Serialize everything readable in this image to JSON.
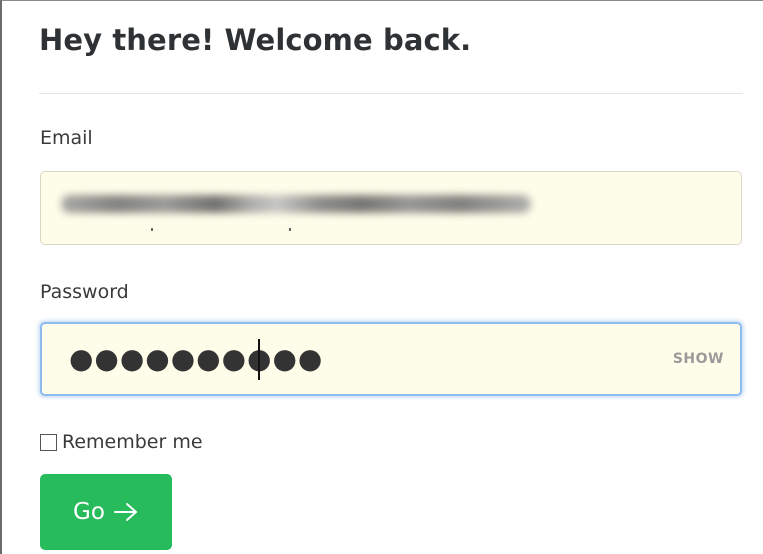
{
  "header": {
    "title": "Hey there! Welcome back."
  },
  "form": {
    "email": {
      "label": "Email",
      "value_state": "blurred"
    },
    "password": {
      "label": "Password",
      "masked_value": "●●●●●●●●●●",
      "show_label": "SHOW"
    },
    "remember": {
      "label": "Remember me",
      "checked": false
    },
    "submit": {
      "label": "Go",
      "icon": "arrow-right-icon"
    }
  },
  "colors": {
    "input_bg": "#fefde9",
    "focus_border": "#8cbcf0",
    "button_bg": "#27bb5c"
  }
}
